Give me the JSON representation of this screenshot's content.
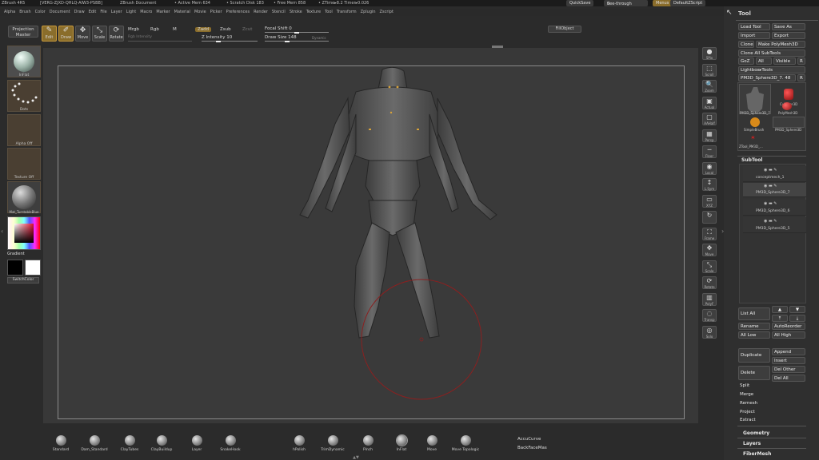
{
  "titlebar": {
    "app": "ZBrush 4R5",
    "id": "[VERG-ZJXD-QHLQ-AIW3-PSBB]",
    "doc": "ZBrush Document",
    "active_mem": "• Active Mem 634",
    "scratch": "• Scratch Disk 183",
    "free_mem": "• Free Mem 858",
    "ztime": "• ZTime▸8.2 Timer▸0.026",
    "quicksave": "QuickSave",
    "seethrough": "See-through",
    "seethrough_value": "0",
    "menus_btn": "Menus",
    "script": "DefaultZScript"
  },
  "menubar": [
    "Alpha",
    "Brush",
    "Color",
    "Document",
    "Draw",
    "Edit",
    "File",
    "Layer",
    "Light",
    "Macro",
    "Marker",
    "Material",
    "Movie",
    "Picker",
    "Preferences",
    "Render",
    "Stencil",
    "Stroke",
    "Texture",
    "Tool",
    "Transform",
    "Zplugin",
    "Zscript"
  ],
  "toolbar": {
    "projection_master": "Projection Master",
    "edit": "Edit",
    "draw": "Draw",
    "move": "Move",
    "scale": "Scale",
    "rotate": "Rotate",
    "mrgb": "Mrgb",
    "rgb": "Rgb",
    "m": "M",
    "rgb_intensity": "Rgb Intensity",
    "zadd": "Zadd",
    "zsub": "Zsub",
    "zcut": "Zcut",
    "z_intensity": "Z Intensity 10",
    "focal_shift": "Focal Shift 0",
    "draw_size": "Draw Size 148",
    "dynamic": "Dynamic",
    "fill_object": "FillObject"
  },
  "leftshelf": {
    "brush_label": "InFlat",
    "stroke_label": "Dots",
    "alpha_label": "Alpha Off",
    "texture_label": "Texture Off",
    "material_label": "Mat_TurntableBlue",
    "gradient": "Gradient",
    "switch_color": "SwitchColor"
  },
  "rightshelf": [
    {
      "icon": "●",
      "label": "SPix",
      "name": "spix"
    },
    {
      "icon": "⬚",
      "label": "Scroll",
      "name": "scroll"
    },
    {
      "icon": "🔍",
      "label": "Zoom",
      "name": "zoom"
    },
    {
      "icon": "▣",
      "label": "Actual",
      "name": "actual"
    },
    {
      "icon": "▢",
      "label": "AAHalf",
      "name": "aahalf"
    },
    {
      "icon": "▦",
      "label": "Persp",
      "name": "persp"
    },
    {
      "icon": "─",
      "label": "Floor",
      "name": "floor"
    },
    {
      "icon": "◉",
      "label": "Local",
      "name": "local"
    },
    {
      "icon": "↕",
      "label": "L.Sym",
      "name": "lsym"
    },
    {
      "icon": "▭",
      "label": "XYZ",
      "name": "xyz"
    },
    {
      "icon": "↻",
      "label": "",
      "name": "rotate-view"
    },
    {
      "icon": "⛶",
      "label": "Frame",
      "name": "frame"
    },
    {
      "icon": "✥",
      "label": "Move",
      "name": "move-view"
    },
    {
      "icon": "⤡",
      "label": "Scale",
      "name": "scale-view"
    },
    {
      "icon": "⟳",
      "label": "Rotate",
      "name": "rotate-tool"
    },
    {
      "icon": "▥",
      "label": "PolyF",
      "name": "polyf"
    },
    {
      "icon": "◌",
      "label": "Transp",
      "name": "transp"
    },
    {
      "icon": "◎",
      "label": "Solo",
      "name": "solo"
    }
  ],
  "tool_panel": {
    "title": "Tool",
    "load_tool": "Load Tool",
    "save_as": "Save As",
    "import": "Import",
    "export": "Export",
    "clone": "Clone",
    "make_polymesh": "Make PolyMesh3D",
    "clone_all": "Clone All SubTools",
    "goz": "GoZ",
    "all": "All",
    "visible": "Visible",
    "r": "R",
    "lightbox_tools": "Lightbox▸Tools",
    "current_tool": "PM3D_Sphere3D_7. 48",
    "r2": "R",
    "thumbs": [
      "PM3D_Sphere3D_7",
      "Cylinder3D",
      "PolyMesh3D",
      "SimpleBrush",
      "PM3D_Sphere3D",
      "ZTool_PM3D_..."
    ],
    "subtool_header": "SubTool",
    "subtools": [
      "conceptmech_1",
      "PM3D_Sphere3D_7",
      "PM3D_Sphere3D_6",
      "PM3D_Sphere3D_5"
    ],
    "list_all": "List All",
    "rename": "Rename",
    "auto_reorder": "AutoReorder",
    "all_low": "All Low",
    "all_high": "All High",
    "duplicate": "Duplicate",
    "append": "Append",
    "insert": "Insert",
    "delete": "Delete",
    "del_other": "Del Other",
    "del_all": "Del All",
    "split": "Split",
    "merge": "Merge",
    "remesh": "Remesh",
    "project": "Project",
    "extract": "Extract",
    "geometry": "Geometry",
    "layers": "Layers",
    "fibermesh": "FiberMesh"
  },
  "brushes": [
    "Standard",
    "Dam_Standard",
    "ClayTubes",
    "ClayBuildup",
    "Layer",
    "SnakeHook",
    "hPolish",
    "TrimDynamic",
    "Pinch",
    "InFlat",
    "Move",
    "Move Topologic"
  ],
  "brush_extra": {
    "accucurve": "AccuCurve",
    "backfacemask": "BackFaceMas"
  },
  "colors": {
    "accent": "#c99a3c",
    "brush_ring": "#8a2020",
    "background": "#383838"
  }
}
